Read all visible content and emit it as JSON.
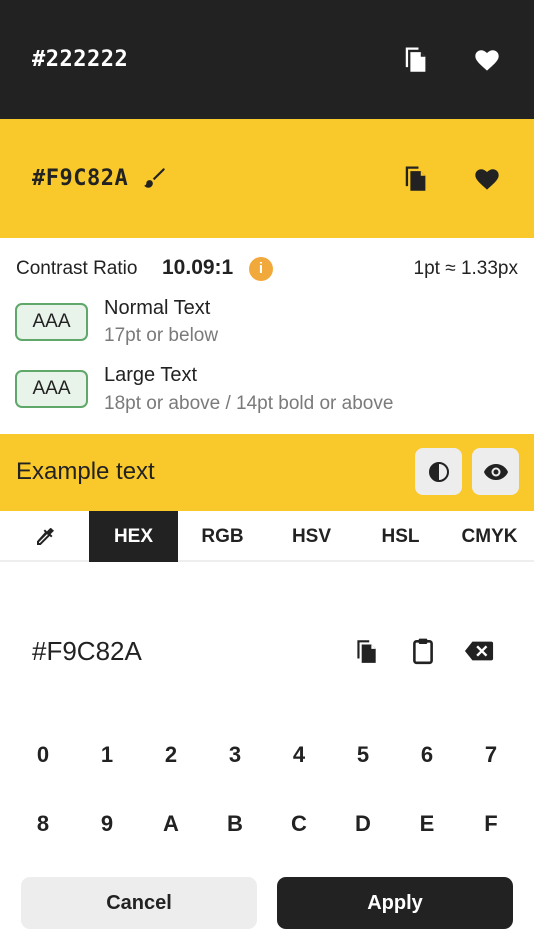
{
  "foreground": {
    "hex": "#222222",
    "icons": [
      "copy-icon",
      "heart-icon"
    ]
  },
  "background": {
    "hex": "#F9C82A",
    "icons": [
      "brush-icon",
      "copy-icon",
      "heart-icon"
    ]
  },
  "contrast": {
    "label": "Contrast Ratio",
    "value": "10.09:1",
    "info_glyph": "i",
    "pt_px": "1pt ≈ 1.33px",
    "normal": {
      "badge": "AAA",
      "title": "Normal Text",
      "subtitle": "17pt or below"
    },
    "large": {
      "badge": "AAA",
      "title": "Large Text",
      "subtitle": "18pt or above / 14pt bold or above"
    }
  },
  "example": {
    "text": "Example text",
    "icons": [
      "contrast-icon",
      "eye-icon"
    ]
  },
  "tabs": [
    {
      "label": "",
      "icon": "eyedropper-icon"
    },
    {
      "label": "HEX",
      "active": true
    },
    {
      "label": "RGB"
    },
    {
      "label": "HSV"
    },
    {
      "label": "HSL"
    },
    {
      "label": "CMYK"
    }
  ],
  "input": {
    "value": "#F9C82A",
    "icons": [
      "copy-icon",
      "paste-icon",
      "backspace-icon"
    ]
  },
  "keypad": {
    "row1": [
      "0",
      "1",
      "2",
      "3",
      "4",
      "5",
      "6",
      "7"
    ],
    "row2": [
      "8",
      "9",
      "A",
      "B",
      "C",
      "D",
      "E",
      "F"
    ]
  },
  "actions": {
    "cancel": "Cancel",
    "apply": "Apply"
  },
  "colors": {
    "dark": "#222222",
    "accent": "#F9C82A",
    "badge_border": "#5FA86A",
    "info": "#F2A93B"
  }
}
